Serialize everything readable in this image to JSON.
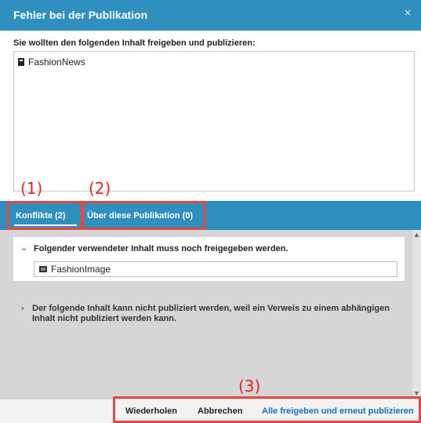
{
  "dialog": {
    "title": "Fehler bei der Publikation",
    "close_glyph": "×",
    "prompt": "Sie wollten den folgenden Inhalt freigeben und publizieren:",
    "items": [
      {
        "label": "FashionNews",
        "icon": "document-icon"
      }
    ]
  },
  "tabs": [
    {
      "label": "Konflikte (2)",
      "active": true
    },
    {
      "label": "Über diese Publikation (0)",
      "active": false
    }
  ],
  "conflicts": {
    "section1": {
      "expanded": true,
      "title": "Folgender verwendeter Inhalt muss noch freigegeben werden.",
      "items": [
        {
          "label": "FashionImage",
          "icon": "image-icon"
        }
      ]
    },
    "section2": {
      "expanded": false,
      "title": "Der folgende Inhalt kann nicht publiziert werden, weil ein Verweis zu einem abhängigen Inhalt nicht publiziert werden kann."
    }
  },
  "footer": {
    "retry_label": "Wiederholen",
    "cancel_label": "Abbrechen",
    "primary_label": "Alle freigeben und erneut publizieren"
  },
  "annotations": {
    "a1": "(1)",
    "a2": "(2)",
    "a3": "(3)"
  },
  "colors": {
    "accent": "#2f8fbf",
    "primary_link": "#1a6fb0",
    "annotation": "#e0261f"
  }
}
